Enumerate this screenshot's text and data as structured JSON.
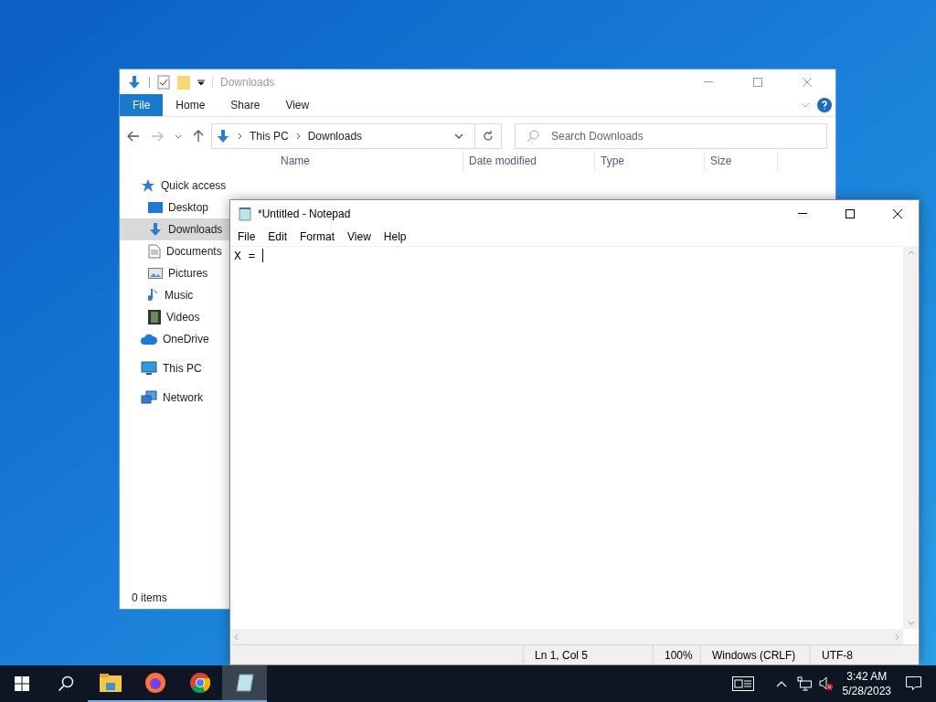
{
  "explorer": {
    "title": "Downloads",
    "ribbon_tabs": [
      {
        "label": "File",
        "selected": true
      },
      {
        "label": "Home",
        "selected": false
      },
      {
        "label": "Share",
        "selected": false
      },
      {
        "label": "View",
        "selected": false
      }
    ],
    "path": [
      "This PC",
      "Downloads"
    ],
    "search": {
      "placeholder": "Search Downloads"
    },
    "columns": [
      "Name",
      "Date modified",
      "Type",
      "Size"
    ],
    "sidebar": [
      {
        "label": "Quick access",
        "selected": false,
        "children": [
          {
            "label": "Desktop",
            "selected": false
          },
          {
            "label": "Downloads",
            "selected": true
          },
          {
            "label": "Documents",
            "selected": false
          },
          {
            "label": "Pictures",
            "selected": false
          },
          {
            "label": "Music",
            "selected": false
          },
          {
            "label": "Videos",
            "selected": false
          }
        ]
      },
      {
        "label": "OneDrive",
        "selected": false
      },
      {
        "label": "This PC",
        "selected": false
      },
      {
        "label": "Network",
        "selected": false
      }
    ],
    "status_bar": "0 items"
  },
  "notepad": {
    "title": "*Untitled - Notepad",
    "menu": [
      "File",
      "Edit",
      "Format",
      "View",
      "Help"
    ],
    "text": "X = ",
    "status_bar": [
      "Ln 1, Col 5",
      "100%",
      "Windows (CRLF)",
      "UTF-8"
    ]
  },
  "taskbar": {
    "apps": [
      {
        "kind": "explorer",
        "selected": false
      },
      {
        "kind": "firefox",
        "selected": false
      },
      {
        "kind": "chrome",
        "selected": false
      },
      {
        "kind": "notepad",
        "selected": true
      }
    ],
    "time": "3:42 AM",
    "date": "5/28/2023"
  }
}
